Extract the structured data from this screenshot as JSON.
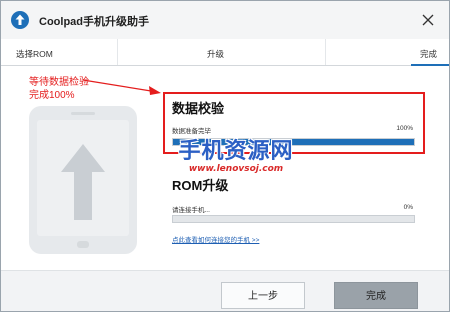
{
  "window": {
    "title": "Coolpad手机升级助手",
    "close_symbol": "✕"
  },
  "steps": [
    {
      "label": "选择ROM"
    },
    {
      "label": "升级"
    },
    {
      "label": "完成"
    }
  ],
  "annotation": {
    "line1": "等待数据检验",
    "line2": "完成100%"
  },
  "verify": {
    "title": "数据校验",
    "status": "数据准备完毕",
    "percent_text": "100%",
    "progress": 1.0
  },
  "watermark": {
    "cn": "手机资源网",
    "en": "www.lenovsoj.com"
  },
  "rom": {
    "title": "ROM升级",
    "status": "请连接手机...",
    "percent_text": "0%",
    "progress": 0.0
  },
  "help_link": "点此查看如何连接您的手机 >>",
  "buttons": {
    "prev": "上一步",
    "finish": "完成"
  },
  "colors": {
    "accent": "#1e6fb8",
    "annotation_red": "#e41d1d"
  }
}
